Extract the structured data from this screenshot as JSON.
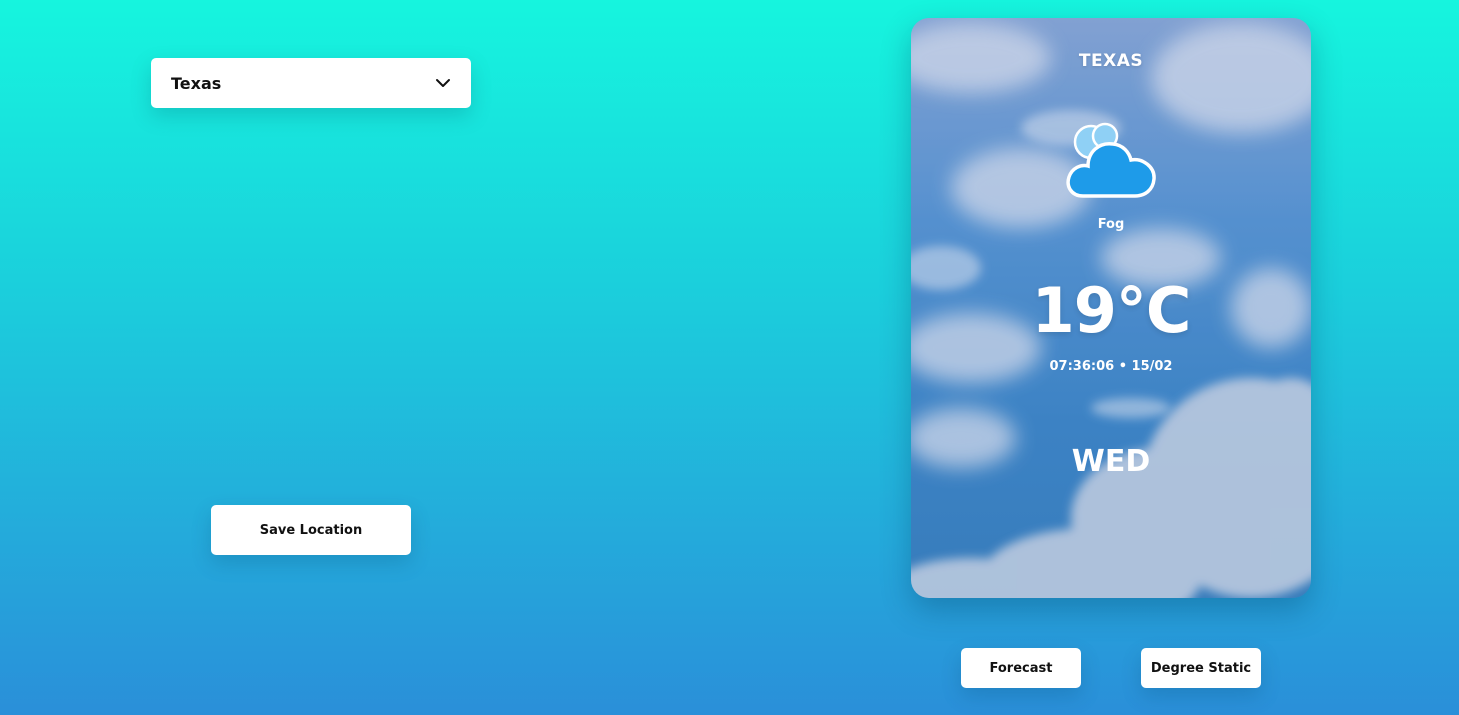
{
  "location_select": {
    "selected": "Texas"
  },
  "buttons": {
    "save_location": "Save Location",
    "forecast": "Forecast",
    "degree_static": "Degree Static"
  },
  "weather_card": {
    "city": "TEXAS",
    "condition": "Fog",
    "icon": "cloud-icon",
    "temperature": "19°C",
    "time": "07:36:06",
    "separator": "•",
    "date": "15/02",
    "day": "WED"
  },
  "colors": {
    "bg_top": "#16f5de",
    "bg_bottom": "#2a8fd9",
    "cloud_icon": "#1e9be9",
    "card_sky": "#4a8fcf"
  }
}
